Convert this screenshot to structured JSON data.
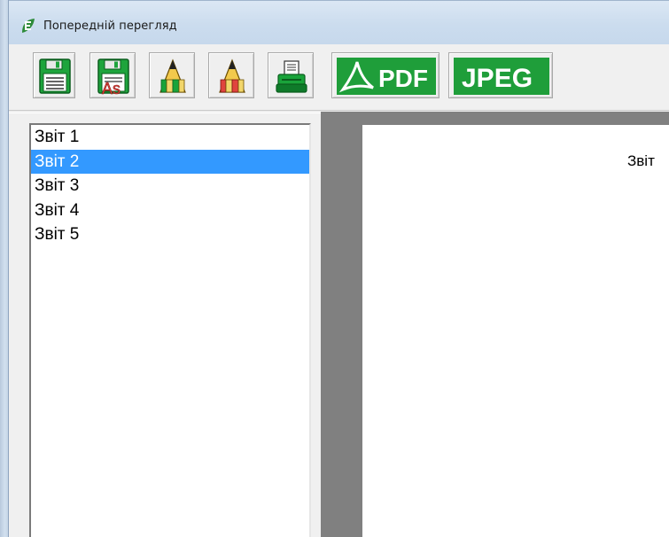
{
  "window": {
    "title": "Попередній перегляд",
    "app_icon": "app-leaf-icon"
  },
  "toolbar": {
    "buttons": [
      {
        "name": "save-button",
        "icon": "floppy-disk-icon"
      },
      {
        "name": "save-as-button",
        "icon": "floppy-disk-save-as-icon",
        "badge": "As"
      },
      {
        "name": "edit-green-button",
        "icon": "pencils-green-icon"
      },
      {
        "name": "edit-red-button",
        "icon": "pencils-red-icon"
      },
      {
        "name": "print-button",
        "icon": "printer-icon"
      },
      {
        "name": "export-pdf-button",
        "icon": "pdf-icon",
        "label": "PDF"
      },
      {
        "name": "export-jpeg-button",
        "icon": "jpeg-icon",
        "label": "JPEG"
      }
    ]
  },
  "reports": {
    "items": [
      "Звіт 1",
      "Звіт 2",
      "Звіт 3",
      "Звіт 4",
      "Звіт 5"
    ],
    "selected_index": 1
  },
  "preview": {
    "page_title": "Звіт"
  },
  "colors": {
    "selection": "#3399ff",
    "export_green": "#1f9e3a",
    "preview_background": "#808080"
  }
}
